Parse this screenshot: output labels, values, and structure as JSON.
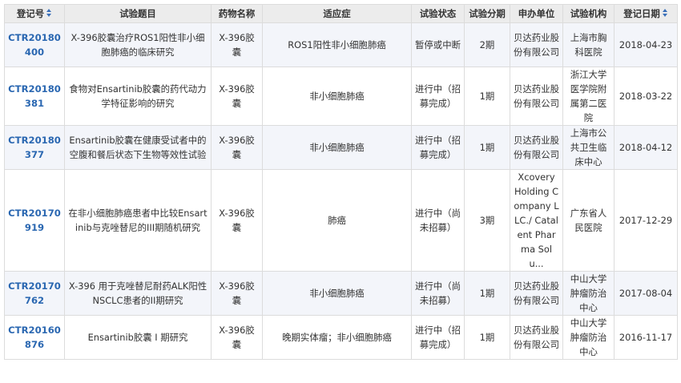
{
  "columns": [
    {
      "label": "登记号",
      "sortable": true
    },
    {
      "label": "试验题目",
      "sortable": false
    },
    {
      "label": "药物名称",
      "sortable": false
    },
    {
      "label": "适应症",
      "sortable": false
    },
    {
      "label": "试验状态",
      "sortable": false
    },
    {
      "label": "试验分期",
      "sortable": false
    },
    {
      "label": "申办单位",
      "sortable": false
    },
    {
      "label": "试验机构",
      "sortable": false
    },
    {
      "label": "登记日期",
      "sortable": true
    }
  ],
  "rows": [
    {
      "reg": "CTR20180400",
      "title": "X-396胶囊治疗ROS1阳性非小细胞肺癌的临床研究",
      "drug": "X-396胶囊",
      "indication": "ROS1阳性非小细胞肺癌",
      "status": "暂停或中断",
      "phase": "2期",
      "sponsor": "贝达药业股份有限公司",
      "site": "上海市胸科医院",
      "date": "2018-04-23"
    },
    {
      "reg": "CTR20180381",
      "title": "食物对Ensartinib胶囊的药代动力学特征影响的研究",
      "drug": "X-396胶囊",
      "indication": "非小细胞肺癌",
      "status": "进行中（招募完成）",
      "phase": "1期",
      "sponsor": "贝达药业股份有限公司",
      "site": "浙江大学医学院附属第二医院",
      "date": "2018-03-22"
    },
    {
      "reg": "CTR20180377",
      "title": "Ensartinib胶囊在健康受试者中的空腹和餐后状态下生物等效性试验",
      "drug": "X-396胶囊",
      "indication": "非小细胞肺癌",
      "status": "进行中（招募完成）",
      "phase": "1期",
      "sponsor": "贝达药业股份有限公司",
      "site": "上海市公共卫生临床中心",
      "date": "2018-04-12"
    },
    {
      "reg": "CTR20170919",
      "title": "在非小细胞肺癌患者中比较Ensartinib与克唑替尼的III期随机研究",
      "drug": "X-396胶囊",
      "indication": "肺癌",
      "status": "进行中（尚未招募）",
      "phase": "3期",
      "sponsor": "Xcovery Holding Company LLC./ Catalent Pharma Solu...",
      "site": "广东省人民医院",
      "date": "2017-12-29"
    },
    {
      "reg": "CTR20170762",
      "title": "X-396 用于克唑替尼耐药ALK阳性NSCLC患者的II期研究",
      "drug": "X-396胶囊",
      "indication": "非小细胞肺癌",
      "status": "进行中（尚未招募）",
      "phase": "1期",
      "sponsor": "贝达药业股份有限公司",
      "site": "中山大学肿瘤防治中心",
      "date": "2017-08-04"
    },
    {
      "reg": "CTR20160876",
      "title": "Ensartinib胶囊 I 期研究",
      "drug": "X-396胶囊",
      "indication": "晚期实体瘤；非小细胞肺癌",
      "status": "进行中（招募完成）",
      "phase": "1期",
      "sponsor": "贝达药业股份有限公司",
      "site": "中山大学肿瘤防治中心",
      "date": "2016-11-17"
    }
  ]
}
